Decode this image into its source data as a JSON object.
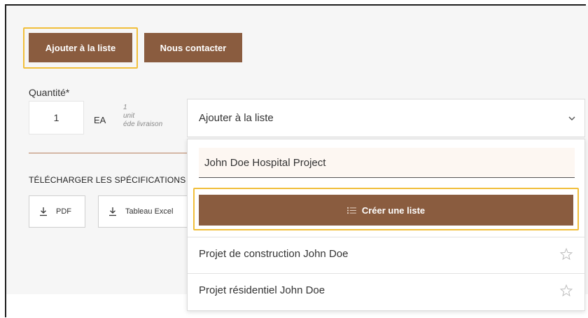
{
  "actions": {
    "add_to_list": "Ajouter à la liste",
    "contact_us": "Nous contacter"
  },
  "quantity": {
    "label": "Quantité*",
    "value": "1",
    "unit": "EA",
    "unit_note": [
      "1",
      "unit",
      "éde livraison"
    ]
  },
  "downloads": {
    "title": "TÉLÉCHARGER LES SPÉCIFICATIONS",
    "pdf_label": "PDF",
    "excel_label": "Tableau Excel"
  },
  "list_dropdown": {
    "selected": "Ajouter à la liste",
    "new_list_value": "John Doe Hospital Project",
    "create_label": "Créer une liste",
    "items": [
      {
        "label": "Projet de construction John Doe"
      },
      {
        "label": "Projet résidentiel John Doe"
      }
    ]
  },
  "colors": {
    "accent": "#8a5c3f",
    "highlight": "#f1bf3b",
    "divider": "#b57e5d"
  },
  "icons": [
    "download-icon",
    "chevron-down-icon",
    "list-icon",
    "star-icon"
  ]
}
